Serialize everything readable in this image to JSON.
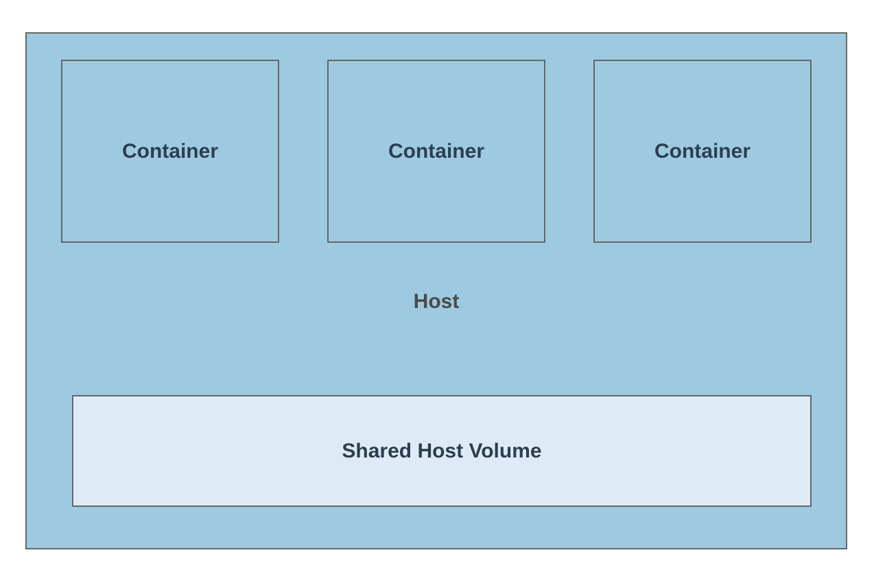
{
  "diagram": {
    "host_label": "Host",
    "containers": [
      {
        "label": "Container"
      },
      {
        "label": "Container"
      },
      {
        "label": "Container"
      }
    ],
    "volume_label": "Shared Host Volume"
  },
  "colors": {
    "host_bg": "#9ecae1",
    "container_bg": "#9ecae1",
    "volume_bg": "#deebf7",
    "border": "#666666",
    "text": "#2c3e50"
  }
}
